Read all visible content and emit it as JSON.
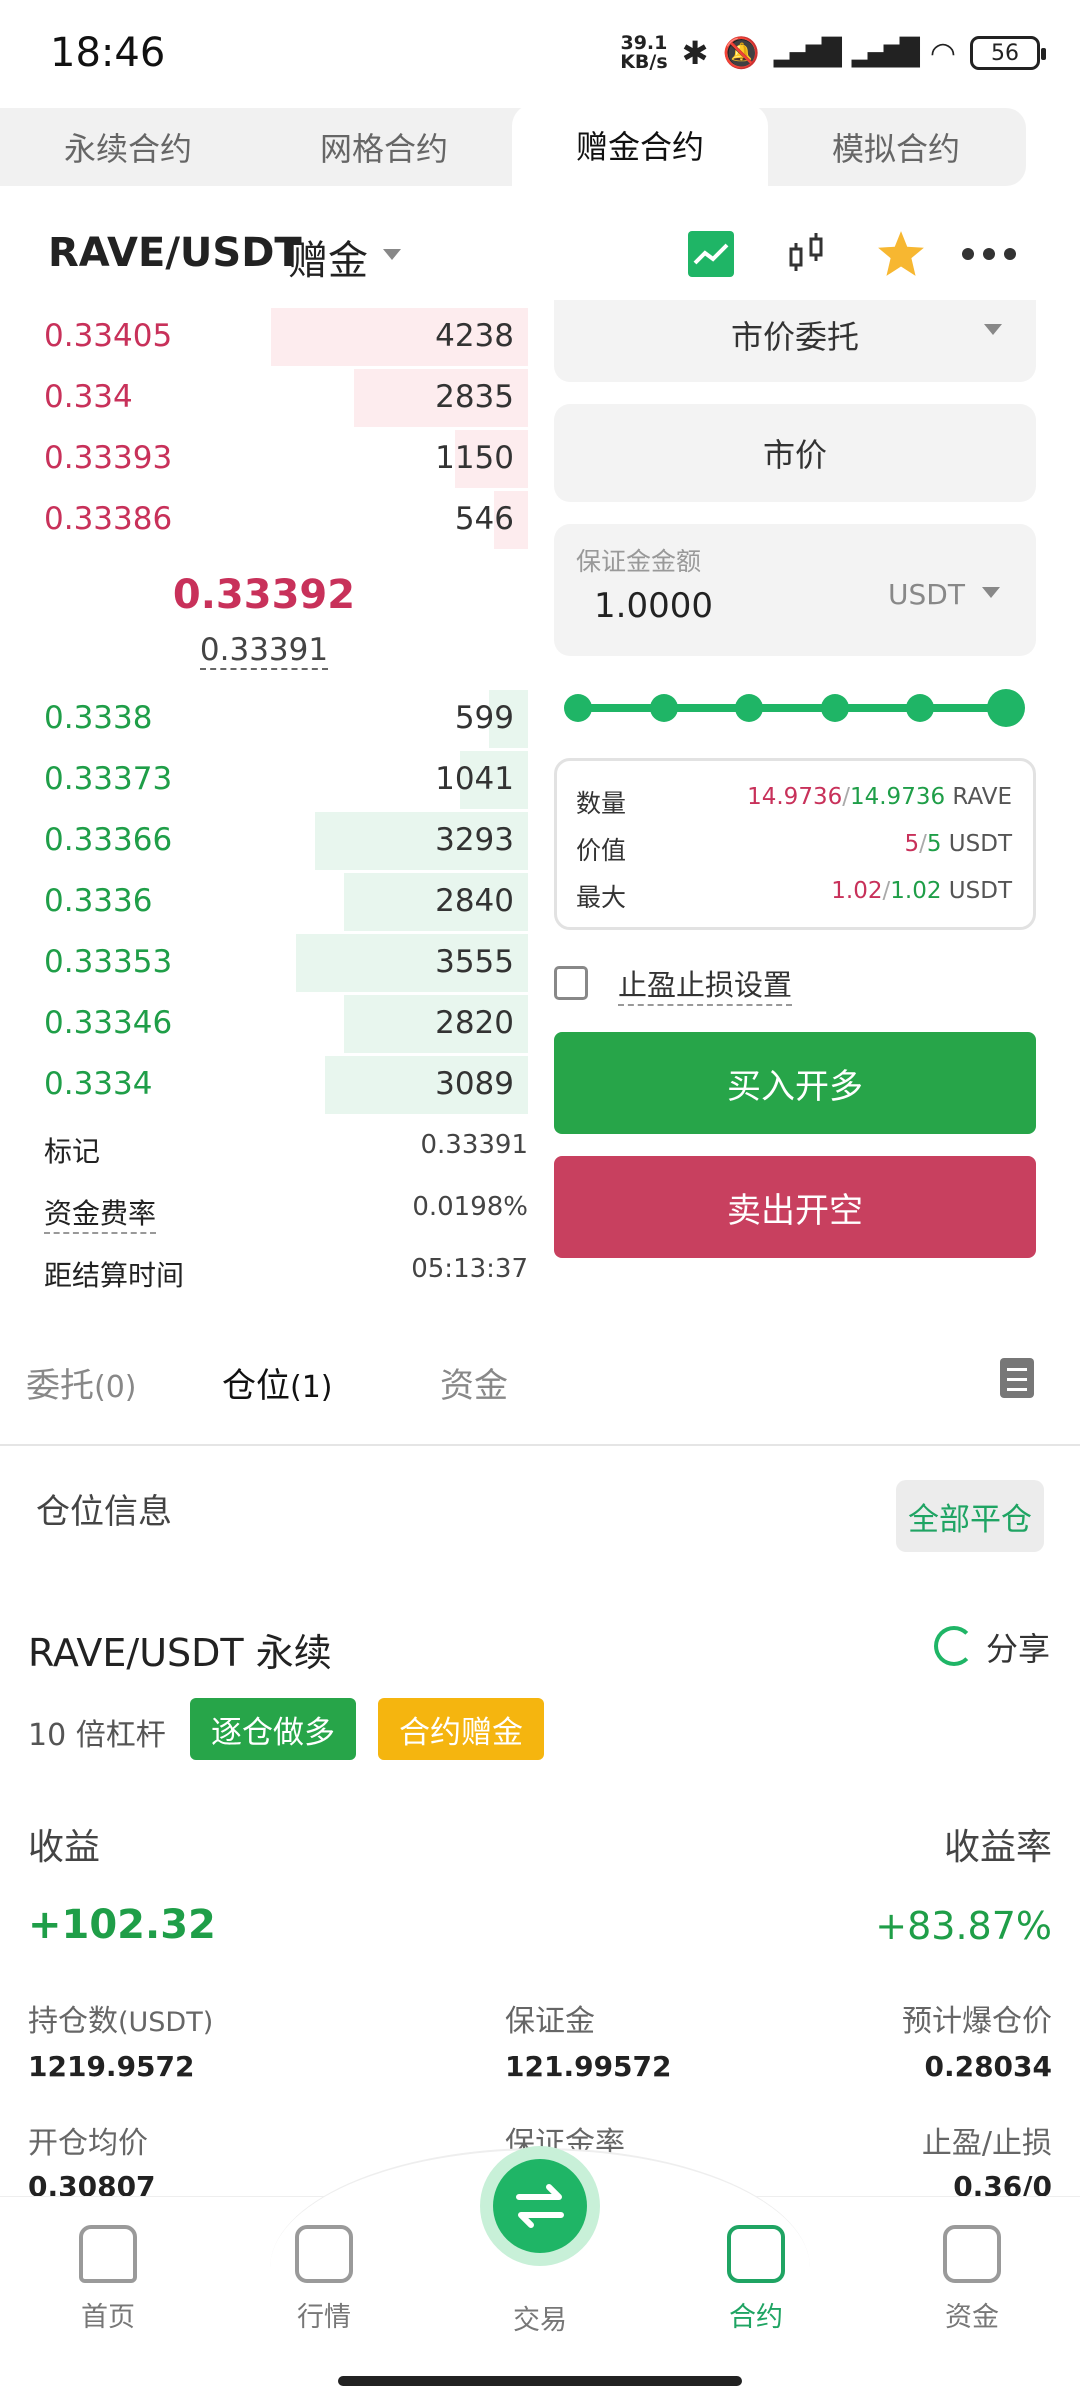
{
  "status": {
    "time": "18:46",
    "net_speed_top": "39.1",
    "net_speed_unit": "KB/s",
    "battery": "56"
  },
  "tabs": [
    {
      "label": "永续合约"
    },
    {
      "label": "网格合约"
    },
    {
      "label": "赠金合约"
    },
    {
      "label": "模拟合约"
    }
  ],
  "header": {
    "pair": "RAVE/USDT",
    "tag": "赠金",
    "icons": [
      "chart-line-icon",
      "candlestick-icon",
      "star-icon",
      "more-icon"
    ]
  },
  "asks": [
    {
      "price": "0.33405",
      "qty": "4238",
      "depth": 0.53
    },
    {
      "price": "0.334",
      "qty": "2835",
      "depth": 0.36
    },
    {
      "price": "0.33393",
      "qty": "1150",
      "depth": 0.15
    },
    {
      "price": "0.33386",
      "qty": "546",
      "depth": 0.07
    }
  ],
  "mid": {
    "last": "0.33392",
    "mark": "0.33391"
  },
  "bids": [
    {
      "price": "0.3338",
      "qty": "599",
      "depth": 0.08
    },
    {
      "price": "0.33373",
      "qty": "1041",
      "depth": 0.14
    },
    {
      "price": "0.33366",
      "qty": "3293",
      "depth": 0.44
    },
    {
      "price": "0.3336",
      "qty": "2840",
      "depth": 0.38
    },
    {
      "price": "0.33353",
      "qty": "3555",
      "depth": 0.48
    },
    {
      "price": "0.33346",
      "qty": "2820",
      "depth": 0.38
    },
    {
      "price": "0.3334",
      "qty": "3089",
      "depth": 0.42
    }
  ],
  "ob_info": [
    {
      "label": "标记",
      "value": "0.33391"
    },
    {
      "label": "资金费率",
      "value": "0.0198%"
    },
    {
      "label": "距结算时间",
      "value": "05:13:37"
    }
  ],
  "order": {
    "type": "市价委托",
    "price": "市价",
    "margin_label": "保证金金额",
    "margin_value": "1.0000",
    "margin_unit": "USDT",
    "slider_level": 1.0,
    "stats": [
      {
        "label": "数量",
        "a": "14.9736",
        "sep": "/",
        "b": "14.9736",
        "unit": "RAVE"
      },
      {
        "label": "价值",
        "a": "5",
        "sep": "/",
        "b": "5",
        "unit": "USDT"
      },
      {
        "label": "最大",
        "a": "1.02",
        "sep": "/",
        "b": "1.02",
        "unit": "USDT"
      }
    ],
    "tpsl_label": "止盈止损设置",
    "buy_label": "买入开多",
    "sell_label": "卖出开空"
  },
  "bottom_tabs": {
    "orders": "委托",
    "orders_count": "(0)",
    "positions": "仓位",
    "positions_count": "(1)",
    "funds": "资金"
  },
  "position": {
    "section_title": "仓位信息",
    "close_all": "全部平仓",
    "symbol": "RAVE/USDT",
    "kind": "永续",
    "share": "分享",
    "leverage": "10 倍杠杆",
    "tag1": "逐仓做多",
    "tag2": "合约赠金",
    "pnl_label": "收益",
    "roe_label": "收益率",
    "pnl": "+102.32",
    "roe": "+83.87%",
    "fields": [
      {
        "label": "持仓数",
        "unit": "(USDT)",
        "value": "1219.9572"
      },
      {
        "label": "保证金",
        "unit": "",
        "value": "121.99572"
      },
      {
        "label": "预计爆仓价",
        "unit": "",
        "value": "0.28034"
      },
      {
        "label": "开仓均价",
        "unit": "",
        "value": "0.30807"
      },
      {
        "label": "保证金率",
        "unit": "",
        "value": ""
      },
      {
        "label": "止盈/止损",
        "unit": "",
        "value": "0.36/0"
      }
    ]
  },
  "nav": [
    {
      "label": "首页",
      "icon": "home-icon"
    },
    {
      "label": "行情",
      "icon": "market-icon"
    },
    {
      "label": "交易",
      "icon": "swap-icon"
    },
    {
      "label": "合约",
      "icon": "contract-icon"
    },
    {
      "label": "资金",
      "icon": "wallet-icon"
    }
  ],
  "colors": {
    "red": "#c8315a",
    "green": "#1f9e48",
    "accent": "#1fb566",
    "yellow": "#f0b90b"
  }
}
